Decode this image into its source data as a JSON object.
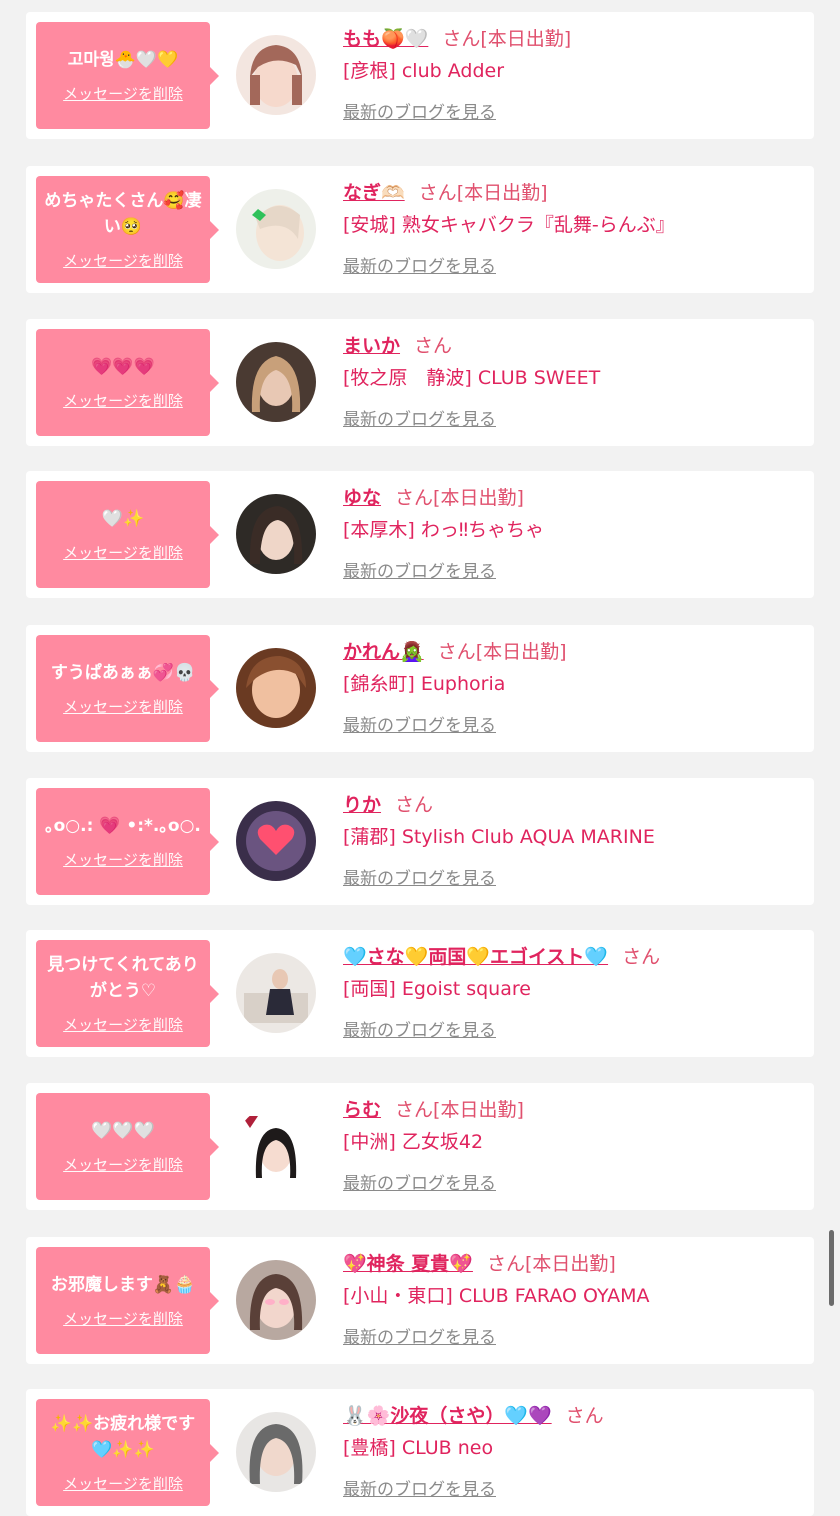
{
  "common": {
    "delete_label": "メッセージを削除",
    "blog_label": "最新のブログを見る",
    "san": "さん",
    "status_today": "[本日出勤]"
  },
  "cards": [
    {
      "message": "고마웡🐣🤍💛",
      "name": "もも🍑🤍",
      "status": "[本日出勤]",
      "shop": "[彦根] club Adder"
    },
    {
      "message": "めちゃたくさん🥰凄い🥺",
      "name": "なぎ🫶🏻",
      "status": "[本日出勤]",
      "shop": "[安城] 熟女キャバクラ『乱舞-らんぶ』"
    },
    {
      "message": "💗💗💗",
      "name": "まいか",
      "status": "",
      "shop": "[牧之原　静波] CLUB SWEET"
    },
    {
      "message": "🤍✨",
      "name": "ゆな",
      "status": "[本日出勤]",
      "shop": "[本厚木] わっ‼︎ちゃちゃ"
    },
    {
      "message": "すうぱあぁぁ💞💀",
      "name": "かれん🧟‍♀️",
      "status": "[本日出勤]",
      "shop": "[錦糸町] Euphoria"
    },
    {
      "message": "｡o○.: 💗 •:*.｡o○.",
      "name": "りか",
      "status": "",
      "shop": "[蒲郡] Stylish Club AQUA MARINE"
    },
    {
      "message": "見つけてくれてありがとう♡",
      "name": "🩵さな💛両国💛エゴイスト🩵",
      "status": "",
      "shop": "[両国] Egoist square"
    },
    {
      "message": "🤍🤍🤍",
      "name": "らむ",
      "status": "[本日出勤]",
      "shop": "[中洲] 乙女坂42"
    },
    {
      "message": "お邪魔します🧸🧁",
      "name": "💖神条 夏貴💖",
      "status": "[本日出勤]",
      "shop": "[小山・東口] CLUB FARAO OYAMA"
    },
    {
      "message": "✨✨お疲れ様です🩵✨✨",
      "name": "🐰🌸沙夜（さや）🩵💜",
      "status": "",
      "shop": "[豊橋] CLUB neo"
    }
  ],
  "colors": {
    "bubble": "#ff8aa0",
    "name": "#e0245e",
    "page_bg": "#f2f2f2",
    "link_gray": "#8a8a8a"
  }
}
